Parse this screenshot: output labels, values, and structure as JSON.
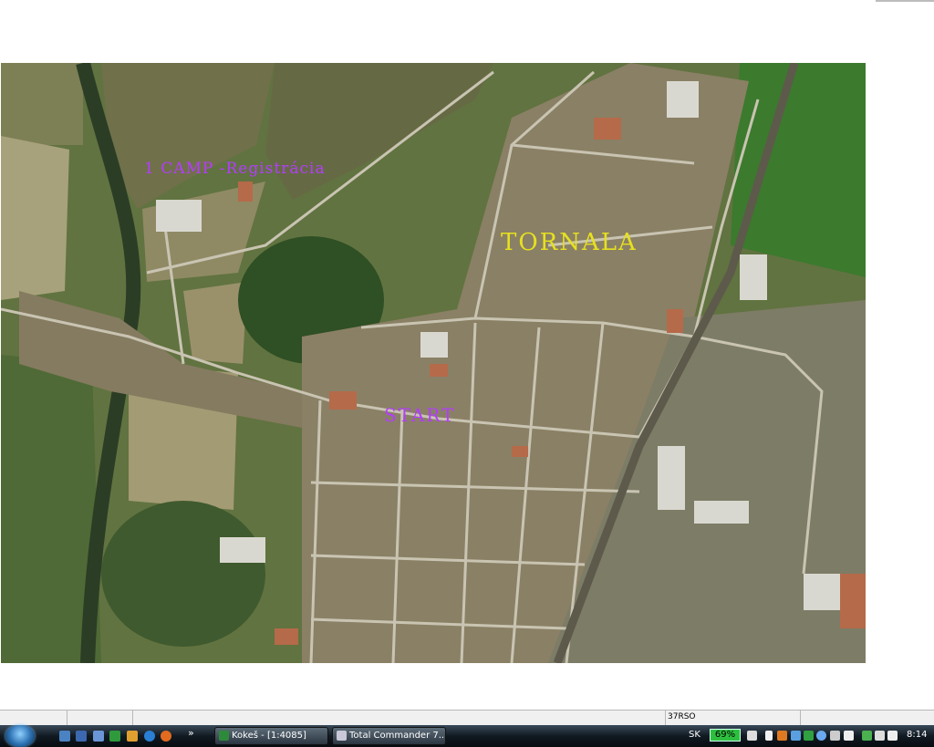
{
  "map": {
    "labels": {
      "camp": "1  CAMP -Registrácia",
      "town": "TORNALA",
      "start": "START"
    },
    "colors": {
      "camp": "#b43cff",
      "town": "#e6e020",
      "start": "#b43cff"
    }
  },
  "statusbar": {
    "code": "37RSO"
  },
  "taskbar": {
    "chevron": "»",
    "buttons": [
      {
        "label": "Kokeš - [1:4085]",
        "icon": "map-app-icon"
      },
      {
        "label": "Total Commander 7...",
        "icon": "floppy-disk-icon"
      }
    ],
    "tray": {
      "language": "SK",
      "battery": "69%",
      "clock": "8:14"
    }
  }
}
